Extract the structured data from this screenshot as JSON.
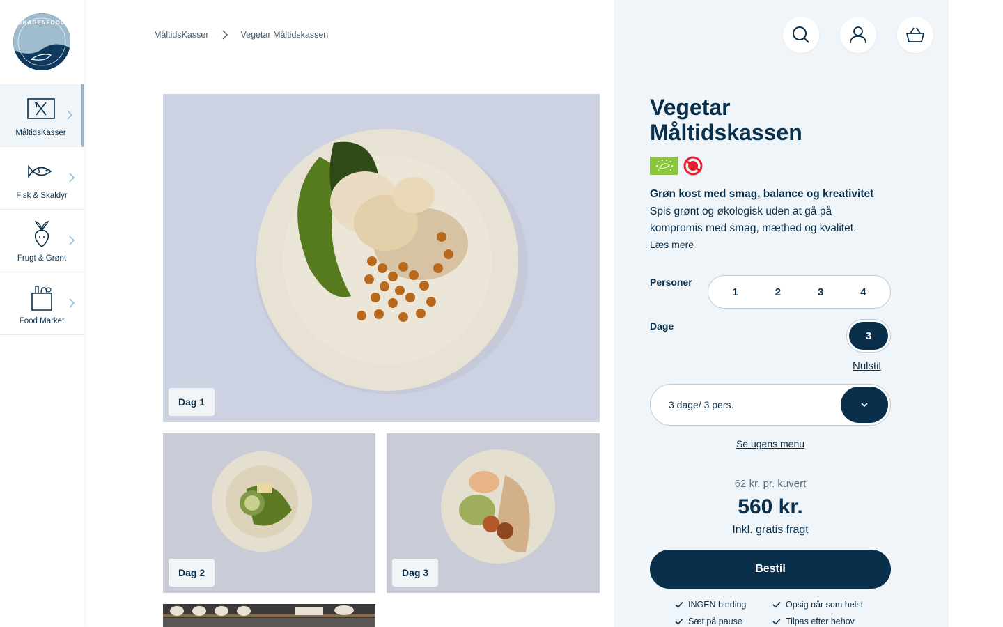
{
  "brand": {
    "logo_text": "SKAGENFOOD"
  },
  "sidebar": {
    "items": [
      {
        "label": "MåltidsKasser",
        "icon": "meal-box-icon",
        "active": true
      },
      {
        "label": "Fisk & Skaldyr",
        "icon": "fish-icon",
        "active": false
      },
      {
        "label": "Frugt & Grønt",
        "icon": "beetroot-icon",
        "active": false
      },
      {
        "label": "Food Market",
        "icon": "grocery-bag-icon",
        "active": false
      }
    ]
  },
  "breadcrumb": {
    "items": [
      "MåltidsKasser",
      "Vegetar Måltidskassen"
    ]
  },
  "gallery": {
    "images": [
      {
        "label": "Dag 1"
      },
      {
        "label": "Dag 2"
      },
      {
        "label": "Dag 3"
      }
    ]
  },
  "header_icons": [
    "search-icon",
    "user-icon",
    "basket-icon"
  ],
  "product": {
    "title": "Vegetar Måltidskassen",
    "badges": [
      "eu-organic-badge",
      "danish-organic-badge"
    ],
    "tagline": "Grøn kost med smag, balance og kreativitet",
    "description": "Spis grønt og økologisk uden at gå på kompromis med smag, mæthed og kvalitet.",
    "read_more": "Læs mere",
    "persons": {
      "label": "Personer",
      "options": [
        "1",
        "2",
        "3",
        "4"
      ]
    },
    "days": {
      "label": "Dage",
      "selected": "3"
    },
    "reset": "Nulstil",
    "select_value": "3 dage/ 3 pers.",
    "menu_link": "Se ugens menu",
    "per_cover": "62 kr. pr. kuvert",
    "price": "560 kr.",
    "shipping": "Inkl. gratis fragt",
    "order_label": "Bestil",
    "perks": [
      "INGEN binding",
      "Opsig når som helst",
      "Sæt på pause",
      "Tilpas efter behov"
    ]
  },
  "colors": {
    "primary": "#0a2f4a",
    "panel_bg": "#f0f5f9",
    "accent": "#8bbbd8",
    "organic_green": "#8cc63f",
    "danish_red": "#e4202e"
  }
}
